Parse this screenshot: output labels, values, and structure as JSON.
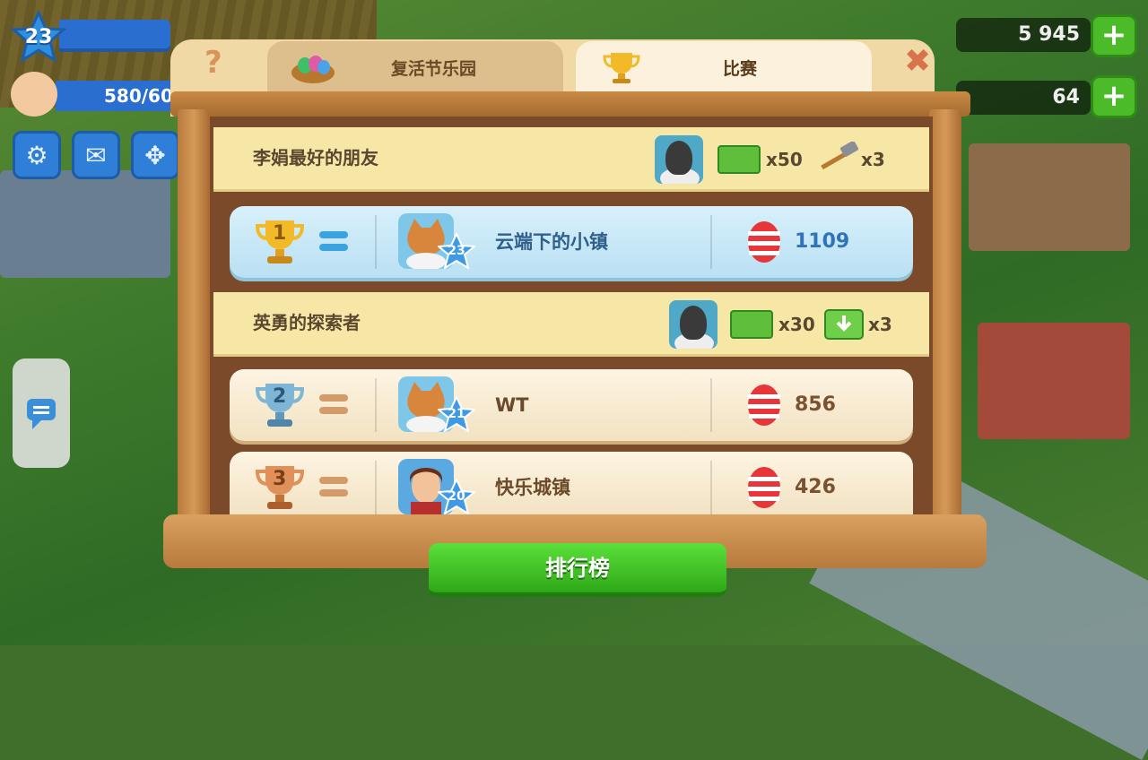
{
  "hud": {
    "level": "23",
    "population": "580/60",
    "coins": "5 945",
    "cash": "64",
    "plus_label": "+"
  },
  "panel": {
    "help_label": "?",
    "close_label": "✖",
    "tabs": [
      {
        "label": "复活节乐园",
        "icon": "easter-basket-icon"
      },
      {
        "label": "比赛",
        "icon": "trophy-icon"
      }
    ],
    "tiers": [
      {
        "name": "李娟最好的朋友",
        "rewards": [
          {
            "icon": "sheep-avatar-icon"
          },
          {
            "icon": "cash-icon",
            "qty": "x50"
          },
          {
            "icon": "hammer-icon",
            "qty": "x3"
          }
        ]
      },
      {
        "name": "英勇的探索者",
        "rewards": [
          {
            "icon": "sheep-avatar-icon"
          },
          {
            "icon": "cash-icon",
            "qty": "x30"
          },
          {
            "icon": "download-ticket-icon",
            "qty": "x3"
          }
        ]
      }
    ],
    "rows": [
      {
        "rank": "1",
        "town": "云端下的小镇",
        "level": "23",
        "score": "1109"
      },
      {
        "rank": "2",
        "town": "WT",
        "level": "21",
        "score": "856"
      },
      {
        "rank": "3",
        "town": "快乐城镇",
        "level": "20",
        "score": "426"
      }
    ],
    "leaderboard_button": "排行榜"
  },
  "colors": {
    "gold": "#f2b928",
    "silver": "#7fb6d6",
    "bronze": "#e0915a",
    "score_blue": "#2f73b8",
    "score_brown": "#7a5230",
    "button_green": "#3fc021"
  }
}
